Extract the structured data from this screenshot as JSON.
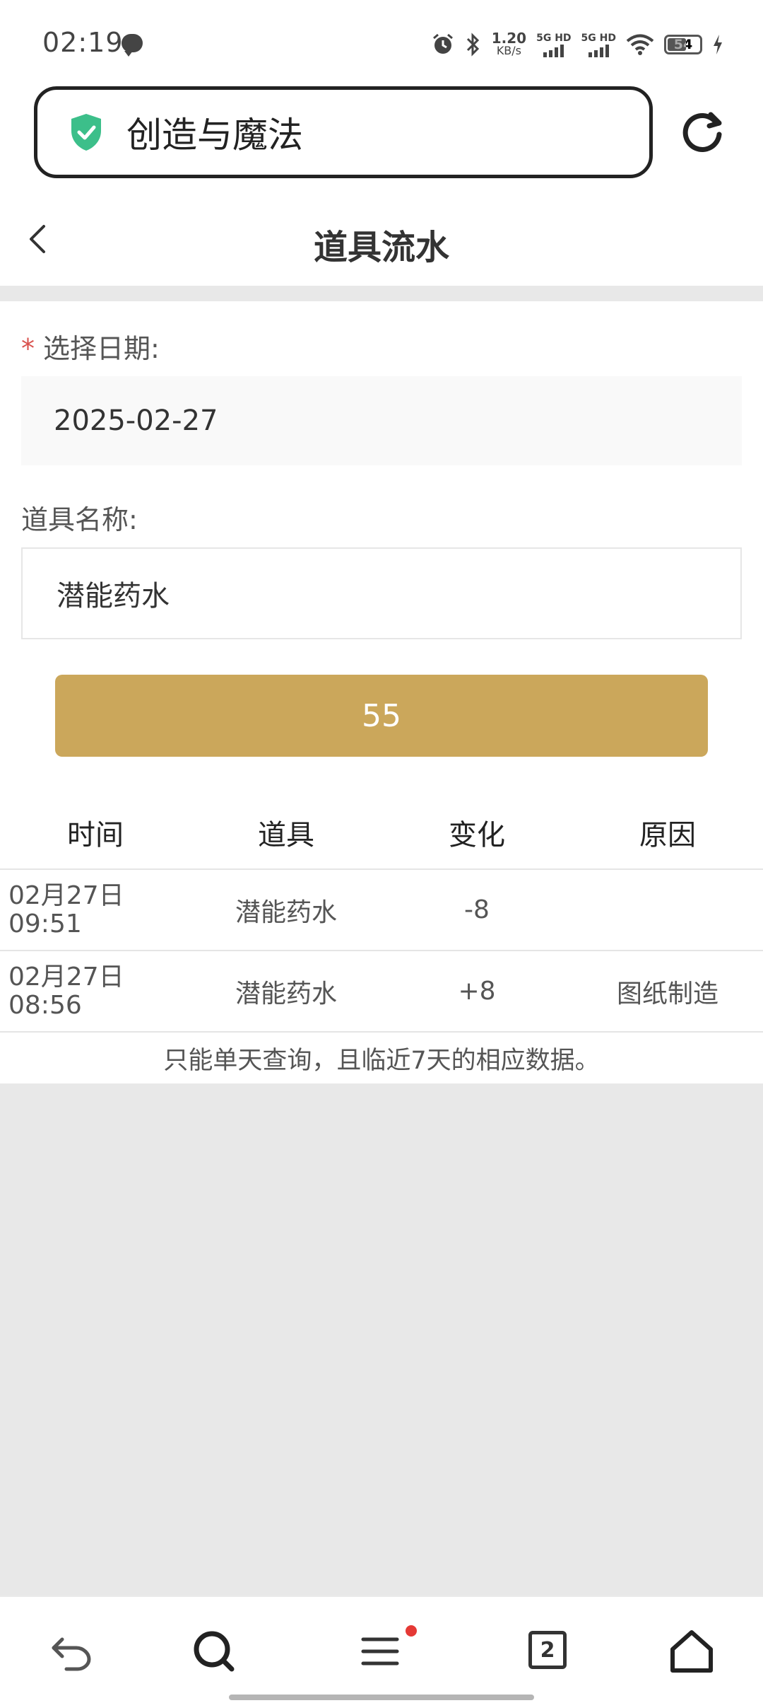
{
  "status": {
    "time": "02:19",
    "net_speed_value": "1.20",
    "net_speed_unit": "KB/s",
    "sim1": "5G HD",
    "sim2": "5G HD",
    "battery": "54"
  },
  "browser": {
    "address_title": "创造与魔法"
  },
  "header": {
    "title": "道具流水"
  },
  "form": {
    "date_required_mark": "*",
    "date_label": "选择日期:",
    "date_value": "2025-02-27",
    "item_label": "道具名称:",
    "item_value": "潜能药水",
    "submit_label": "55"
  },
  "table": {
    "headers": [
      "时间",
      "道具",
      "变化",
      "原因"
    ],
    "rows": [
      {
        "date": "02月27日",
        "time": "09:51",
        "item": "潜能药水",
        "change": "-8",
        "reason": ""
      },
      {
        "date": "02月27日",
        "time": "08:56",
        "item": "潜能药水",
        "change": "+8",
        "reason": "图纸制造"
      }
    ],
    "note": "只能单天查询，且临近7天的相应数据。"
  },
  "bottom_nav": {
    "tab_count": "2"
  },
  "colors": {
    "accent": "#cba75b",
    "shield": "#3cbf8a",
    "required": "#d9534f",
    "badge": "#e53935"
  },
  "icons": [
    "chat-icon",
    "alarm-icon",
    "bluetooth-icon",
    "wifi-icon",
    "battery-icon",
    "charging-icon",
    "shield-check-icon",
    "refresh-icon",
    "chevron-left-icon",
    "back-arrow-icon",
    "search-icon",
    "menu-icon",
    "tabs-icon",
    "home-icon"
  ]
}
